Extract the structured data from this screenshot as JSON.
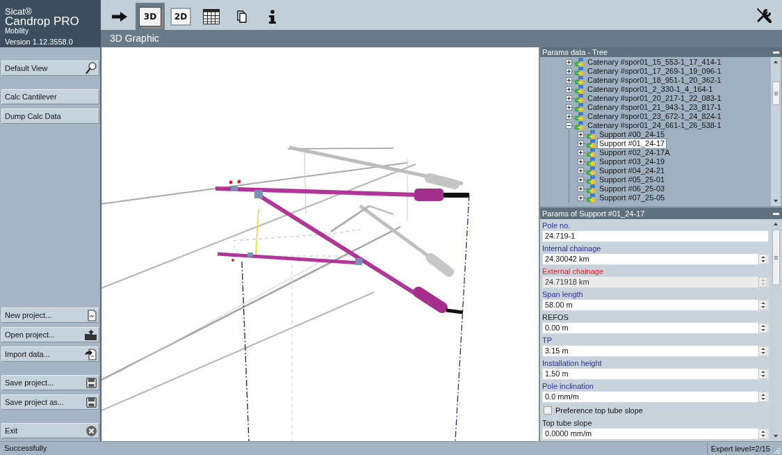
{
  "app": {
    "brand": "Sicat®",
    "product": "Candrop PRO",
    "edition": "Mobility",
    "version": "Version 1.12.3558.0"
  },
  "toolbar": {
    "items": [
      {
        "selected": false
      },
      {
        "label": "3D",
        "selected": true
      },
      {
        "label": "2D",
        "selected": false
      },
      {
        "selected": false
      },
      {
        "selected": false
      },
      {
        "selected": false
      }
    ]
  },
  "view": {
    "title": "3D Graphic"
  },
  "sidebar": {
    "top_sections": [
      [
        {
          "label": "Default View"
        }
      ],
      [
        {
          "label": "Calc Cantilever"
        },
        {
          "label": "Dump Calc Data"
        }
      ]
    ],
    "bottom_sections": [
      [
        {
          "label": "New project..."
        },
        {
          "label": "Open project..."
        },
        {
          "label": "Import data..."
        }
      ],
      [
        {
          "label": "Save project..."
        },
        {
          "label": "Save project as..."
        }
      ],
      [
        {
          "label": "Exit"
        }
      ]
    ]
  },
  "tree": {
    "title": "Params data - Tree",
    "items": [
      {
        "label": "Catenary #spor01_15_553-1_17_414-1",
        "expanded": false,
        "selected": false
      },
      {
        "label": "Catenary #spor01_17_269-1_19_096-1",
        "expanded": false,
        "selected": false
      },
      {
        "label": "Catenary #spor01_18_951-1_20_362-1",
        "expanded": false,
        "selected": false
      },
      {
        "label": "Catenary #spor01_2_330-1_4_164-1",
        "expanded": false,
        "selected": false
      },
      {
        "label": "Catenary #spor01_20_217-1_22_083-1",
        "expanded": false,
        "selected": false
      },
      {
        "label": "Catenary #spor01_21_943-1_23_817-1",
        "expanded": false,
        "selected": false
      },
      {
        "label": "Catenary #spor01_23_672-1_24_824-1",
        "expanded": false,
        "selected": false
      },
      {
        "label": "Catenary #spor01_24_661-1_26_538-1",
        "expanded": true,
        "selected": false,
        "children": [
          {
            "label": "Support #00_24-15",
            "expanded": false,
            "selected": false
          },
          {
            "label": "Support #01_24-17",
            "expanded": false,
            "selected": true
          },
          {
            "label": "Support #02_24-17A",
            "expanded": false,
            "selected": false
          },
          {
            "label": "Support #03_24-19",
            "expanded": false,
            "selected": false
          },
          {
            "label": "Support #04_24-21",
            "expanded": false,
            "selected": false
          },
          {
            "label": "Support #05_25-01",
            "expanded": false,
            "selected": false
          },
          {
            "label": "Support #06_25-03",
            "expanded": false,
            "selected": false
          },
          {
            "label": "Support #07_25-05",
            "expanded": false,
            "selected": false
          }
        ]
      }
    ]
  },
  "params": {
    "title": "Params of Support #01_24-17",
    "fields": [
      {
        "kind": "text",
        "label": "Pole no.",
        "color": "#2f2f9c",
        "value": "24.719-1",
        "disabled": false
      },
      {
        "kind": "spin",
        "label": "Internal chainage",
        "color": "#2f2f9c",
        "value": "24.30042 km",
        "disabled": false
      },
      {
        "kind": "spin",
        "label": "External chainage",
        "color": "#e0262c",
        "value": "24.71918 km",
        "disabled": true
      },
      {
        "kind": "spin",
        "label": "Span length",
        "color": "#2f2f9c",
        "value": "58.00 m",
        "disabled": false
      },
      {
        "kind": "spin",
        "label": "REFOS",
        "color": "#1a1a1a",
        "value": "0.00 m",
        "disabled": false
      },
      {
        "kind": "spin",
        "label": "TP",
        "color": "#2f2f9c",
        "value": "3.15 m",
        "disabled": false
      },
      {
        "kind": "spin",
        "label": "Installation height",
        "color": "#2f2f9c",
        "value": "1.50 m",
        "disabled": false
      },
      {
        "kind": "spin",
        "label": "Pole inclination",
        "color": "#2f2f9c",
        "value": "0.0 mm/m",
        "disabled": false
      },
      {
        "kind": "checkbox",
        "label": "Preference top tube slope",
        "checked": false,
        "disabled": false
      },
      {
        "kind": "spin",
        "label": "Top tube slope",
        "color": "#1a1a1a",
        "value": "0.0000 mm/m",
        "disabled": false
      }
    ]
  },
  "status_bar": {
    "message": "Successfully",
    "expert_level": "Expert level=2/15"
  }
}
